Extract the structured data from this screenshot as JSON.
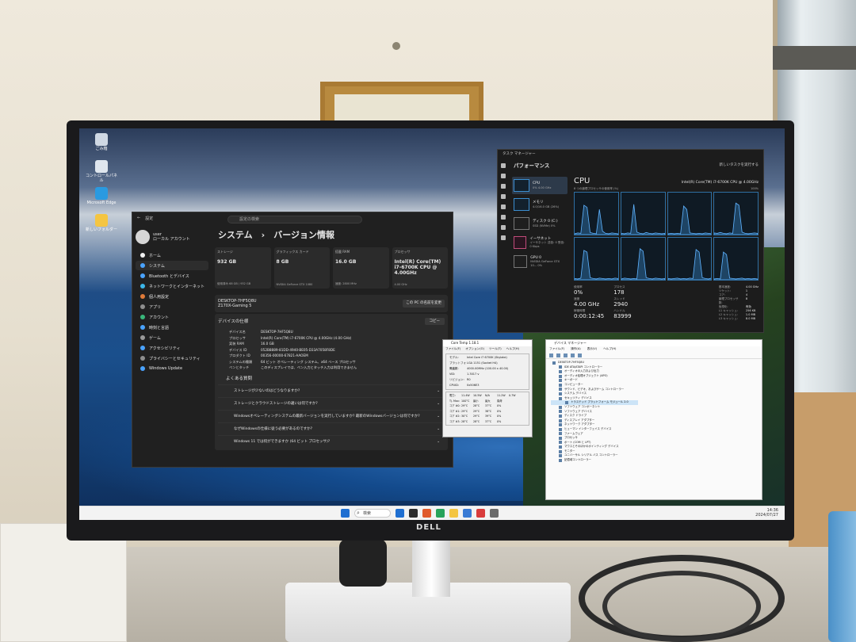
{
  "monitor": {
    "brand": "DELL"
  },
  "desktop_icons": [
    {
      "label": "ごみ箱",
      "color": "#cfd8e3"
    },
    {
      "label": "コントロールパネル",
      "color": "#dfe6ee"
    },
    {
      "label": "Microsoft Edge",
      "color": "#2a9ae0"
    },
    {
      "label": "新しいフォルダー",
      "color": "#f4c542"
    }
  ],
  "settings": {
    "window_title": "設定",
    "search_placeholder": "設定の検索",
    "user_name": "user",
    "user_sub": "ローカル アカウント",
    "page_title": "システム　›　バージョン情報",
    "nav": [
      {
        "label": "ホーム",
        "color": "#f1f1f1"
      },
      {
        "label": "システム",
        "color": "#4aa3ff"
      },
      {
        "label": "Bluetooth とデバイス",
        "color": "#4aa3ff"
      },
      {
        "label": "ネットワークとインターネット",
        "color": "#3cb6e8"
      },
      {
        "label": "個人用設定",
        "color": "#e07b39"
      },
      {
        "label": "アプリ",
        "color": "#8e8e8e"
      },
      {
        "label": "アカウント",
        "color": "#39b77a"
      },
      {
        "label": "時刻と言語",
        "color": "#4aa3ff"
      },
      {
        "label": "ゲーム",
        "color": "#9a9a9a"
      },
      {
        "label": "アクセシビリティ",
        "color": "#4aa3ff"
      },
      {
        "label": "プライバシーとセキュリティ",
        "color": "#8e8e8e"
      },
      {
        "label": "Windows Update",
        "color": "#4aa3ff"
      }
    ],
    "cards": [
      {
        "label": "ストレージ",
        "value": "932 GB",
        "sub": "使用済み 68 GB / 932 GB"
      },
      {
        "label": "グラフィックス カード",
        "value": "8 GB",
        "sub": "NVIDIA GeForce GTX 1080"
      },
      {
        "label": "搭載 RAM",
        "value": "16.0 GB",
        "sub": "速度: 2800 MHz"
      },
      {
        "label": "プロセッサ",
        "value": "Intel(R) Core(TM) i7-6700K CPU @ 4.00GHz",
        "sub": "4.00 GHz"
      }
    ],
    "device_name": "DESKTOP-7HF5Q8U",
    "device_model": "Z170X-Gaming 5",
    "rename_label": "この PC の名前を変更",
    "spec_heading": "デバイスの仕様",
    "copy_label": "コピー",
    "specs": [
      {
        "k": "デバイス名",
        "v": "DESKTOP-7HF5Q8U"
      },
      {
        "k": "プロセッサ",
        "v": "Intel(R) Core(TM) i7-6700K CPU @ 4.00GHz (4.00 GHz)"
      },
      {
        "k": "実装 RAM",
        "v": "16.0 GB"
      },
      {
        "k": "デバイス ID",
        "v": "052B8889-81DD-4940-BE05-D33A7058F8DE"
      },
      {
        "k": "プロダクト ID",
        "v": "00356-00000-67821-AAOEM"
      },
      {
        "k": "システムの種類",
        "v": "64 ビット オペレーティング システム、x64 ベース プロセッサ"
      },
      {
        "k": "ペンとタッチ",
        "v": "このディスプレイでは、ペン入力とタッチ入力は利用できません"
      }
    ],
    "faq_title": "よくある質問",
    "faqs": [
      "ストレージが少ないのはどうなりますか?",
      "ストレージとクラウドストレージの違いは何ですか?",
      "Windowsオペレーティングシステムの最新バージョンを実行していますか? 最新のWindowsバージョンは何ですか?",
      "なぜWindowsの仕様に従う必要があるのですか?",
      "Windows 11 では何ができますか (64 ビット プロセッサ)?"
    ]
  },
  "taskmgr": {
    "window_title": "タスク マネージャー",
    "header_title": "パフォーマンス",
    "header_right": "新しいタスクを実行する",
    "items": [
      {
        "name": "CPU",
        "sub": "0% 4.00 GHz",
        "style": "blue"
      },
      {
        "name": "メモリ",
        "sub": "4.0/16.0 GB (26%)",
        "style": "blue"
      },
      {
        "name": "ディスク 0 (C:)",
        "sub": "SSD (NVMe) 0%",
        "style": "grey"
      },
      {
        "name": "イーサネット",
        "sub": "イーサネット 送信: 0 受信: 0 Kbps",
        "style": "pink"
      },
      {
        "name": "GPU 0",
        "sub": "NVIDIA GeForce GTX 10... 0%",
        "style": "grey"
      }
    ],
    "cpu_title": "CPU",
    "cpu_model": "Intel(R) Core(TM) i7-6700K CPU @ 4.00GHz",
    "graph_label_left": "8 つの論理プロセッサの使用率 (%)",
    "graph_label_right": "100%",
    "graph_series": [
      [
        2,
        4,
        3,
        70,
        65,
        5,
        3,
        2,
        60,
        8,
        3,
        2,
        4,
        3,
        2
      ],
      [
        3,
        2,
        4,
        3,
        72,
        6,
        3,
        2,
        5,
        3,
        2,
        4,
        3,
        2,
        3
      ],
      [
        2,
        3,
        2,
        3,
        2,
        68,
        60,
        4,
        3,
        2,
        3,
        2,
        4,
        3,
        2
      ],
      [
        4,
        3,
        5,
        3,
        2,
        4,
        3,
        75,
        70,
        6,
        3,
        2,
        3,
        4,
        3
      ],
      [
        3,
        2,
        4,
        70,
        66,
        5,
        3,
        2,
        4,
        3,
        2,
        3,
        2,
        4,
        3
      ],
      [
        2,
        4,
        3,
        2,
        3,
        2,
        74,
        68,
        5,
        3,
        2,
        4,
        3,
        2,
        3
      ],
      [
        3,
        2,
        3,
        4,
        2,
        3,
        2,
        4,
        3,
        72,
        66,
        5,
        3,
        2,
        4
      ],
      [
        2,
        3,
        2,
        66,
        60,
        4,
        3,
        2,
        3,
        4,
        2,
        3,
        2,
        3,
        2
      ]
    ],
    "stats": [
      {
        "label": "使用率",
        "value": "0%"
      },
      {
        "label": "速度",
        "value": "4.00 GHz"
      }
    ],
    "stats2": [
      {
        "label": "プロセス",
        "value": "178"
      },
      {
        "label": "スレッド",
        "value": "2940"
      },
      {
        "label": "ハンドル",
        "value": "83999"
      }
    ],
    "uptime_label": "稼働時間",
    "uptime": "0:00:12:45",
    "specs": [
      {
        "k": "基本速度:",
        "v": "4.00 GHz"
      },
      {
        "k": "ソケット:",
        "v": "1"
      },
      {
        "k": "コア:",
        "v": "4"
      },
      {
        "k": "論理プロセッサ数:",
        "v": "8"
      },
      {
        "k": "仮想化:",
        "v": "有効"
      },
      {
        "k": "L1 キャッシュ:",
        "v": "256 KB"
      },
      {
        "k": "L2 キャッシュ:",
        "v": "1.0 MB"
      },
      {
        "k": "L3 キャッシュ:",
        "v": "8.0 MB"
      }
    ]
  },
  "coretemp": {
    "window_title": "Core Temp 1.18.1",
    "menu": [
      "ファイル(F)",
      "オプション(O)",
      "ツール(T)",
      "ヘルプ(H)"
    ],
    "rows": [
      {
        "k": "モデル:",
        "v": "Intel Core i7 6700K (Skylake)"
      },
      {
        "k": "プラットフォーム:",
        "v": "LGA 1151 (Socket H4)"
      },
      {
        "k": "周波数:",
        "v": "4000.00MHz (100.00 x 40.00)"
      },
      {
        "k": "VID:",
        "v": "1.3017 v"
      },
      {
        "k": "リビジョン:",
        "v": "R0"
      },
      {
        "k": "CPUID:",
        "v": "0x506E3"
      }
    ],
    "temps": [
      [
        "電力:",
        "11.4W",
        "10.5W",
        "N/A",
        "11.2W",
        "0.7W"
      ],
      [
        "Tj. Max:",
        "100°C",
        "最小",
        "最大",
        "負荷"
      ],
      [
        "コア #0:",
        "29°C",
        "28°C",
        "37°C",
        "0%"
      ],
      [
        "コア #1:",
        "29°C",
        "29°C",
        "38°C",
        "0%"
      ],
      [
        "コア #2:",
        "30°C",
        "29°C",
        "39°C",
        "0%"
      ],
      [
        "コア #3:",
        "28°C",
        "28°C",
        "37°C",
        "0%"
      ]
    ]
  },
  "devmgr": {
    "window_title": "デバイス マネージャー",
    "menu": [
      "ファイル(F)",
      "操作(A)",
      "表示(V)",
      "ヘルプ(H)"
    ],
    "root": "DESKTOP-7HF5Q8U",
    "nodes": [
      "IDE ATA/ATAPI コントローラー",
      "オーディオの入力および出力",
      "オーディオ処理オブジェクト (APO)",
      "キーボード",
      "コンピューター",
      "サウンド、ビデオ、およびゲーム コントローラー",
      "システム デバイス",
      "セキュリティ デバイス"
    ],
    "selected_child": "トラステッド プラットフォーム モジュール 2.0",
    "nodes2": [
      "ソフトウェア コンポーネント",
      "ソフトウェア デバイス",
      "ディスク ドライブ",
      "ディスプレイ アダプター",
      "ネットワーク アダプター",
      "ヒューマン インターフェイス デバイス",
      "ファームウェア",
      "プロセッサ",
      "ポート (COM と LPT)",
      "マウスとそのほかのポインティング デバイス",
      "モニター",
      "ユニバーサル シリアル バス コントローラー",
      "記憶域コントローラー"
    ]
  },
  "taskbar": {
    "search": "検索",
    "time": "14:36",
    "date": "2024/07/27",
    "icons": [
      "#1f6fd1",
      "#2c2c2c",
      "#e05a2b",
      "#28a35a",
      "#f4c542",
      "#3a7bd5",
      "#d93c3c",
      "#6b6b6b"
    ]
  }
}
